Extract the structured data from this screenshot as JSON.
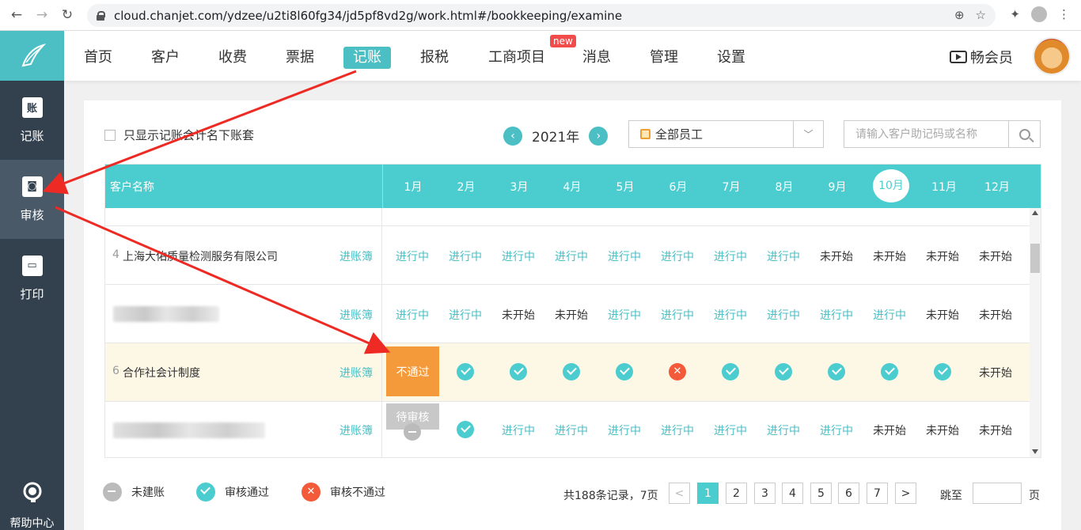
{
  "browser": {
    "url": "cloud.chanjet.com/ydzee/u2ti8l60fg34/jd5pf8vd2g/work.html#/bookkeeping/examine",
    "back_icon": "←",
    "forward_icon": "→",
    "reload_icon": "↻"
  },
  "sidebar": {
    "items": [
      {
        "label": "记账",
        "icon": "账"
      },
      {
        "label": "审核",
        "icon": "◙"
      },
      {
        "label": "打印",
        "icon": "▭"
      }
    ],
    "help": "帮助中心"
  },
  "topnav": {
    "items": [
      "首页",
      "客户",
      "收费",
      "票据",
      "记账",
      "报税",
      "工商项目",
      "消息",
      "管理",
      "设置"
    ],
    "active": "记账",
    "new_badge": "new",
    "member": "畅会员"
  },
  "filters": {
    "only_mine_label": "只显示记账会计名下账套",
    "year": "2021年",
    "employee": "全部员工",
    "search_placeholder": "请输入客户助记码或名称"
  },
  "table": {
    "name_header": "客户名称",
    "months": [
      "1月",
      "2月",
      "3月",
      "4月",
      "5月",
      "6月",
      "7月",
      "8月",
      "9月",
      "10月",
      "11月",
      "12月"
    ],
    "current_month": "10月",
    "ledger_label": "进账簿",
    "rows": [
      {
        "idx": "4",
        "name": "上海大佑质量检测服务有限公司",
        "cells": [
          "进行中",
          "进行中",
          "进行中",
          "进行中",
          "进行中",
          "进行中",
          "进行中",
          "进行中",
          "未开始",
          "未开始",
          "未开始",
          "未开始"
        ]
      },
      {
        "idx": "",
        "name": "",
        "cells": [
          "进行中",
          "进行中",
          "未开始",
          "未开始",
          "进行中",
          "进行中",
          "进行中",
          "进行中",
          "进行中",
          "进行中",
          "未开始",
          "未开始"
        ]
      },
      {
        "idx": "6",
        "name": "合作社会计制度",
        "cells": [
          "不通过",
          "ok",
          "ok",
          "ok",
          "ok",
          "fail",
          "ok",
          "ok",
          "ok",
          "ok",
          "ok",
          "未开始"
        ]
      },
      {
        "idx": "",
        "name": "",
        "cells": [
          "待审核",
          "ok",
          "进行中",
          "进行中",
          "进行中",
          "进行中",
          "进行中",
          "进行中",
          "进行中",
          "未开始",
          "未开始",
          "未开始"
        ]
      }
    ]
  },
  "legend": {
    "not_built": "未建账",
    "passed": "审核通过",
    "failed": "审核不通过"
  },
  "pagination": {
    "summary": "共188条记录，7页",
    "prev": "<",
    "next": ">",
    "pages": [
      "1",
      "2",
      "3",
      "4",
      "5",
      "6",
      "7"
    ],
    "current": "1",
    "jump_label": "跳至",
    "page_unit": "页"
  },
  "colors": {
    "accent": "#4bcdd0",
    "sidebar": "#33414f",
    "fail": "#f25a3a",
    "warning_badge": "#f59a3a",
    "annotation_arrow": "#ee2a24"
  }
}
